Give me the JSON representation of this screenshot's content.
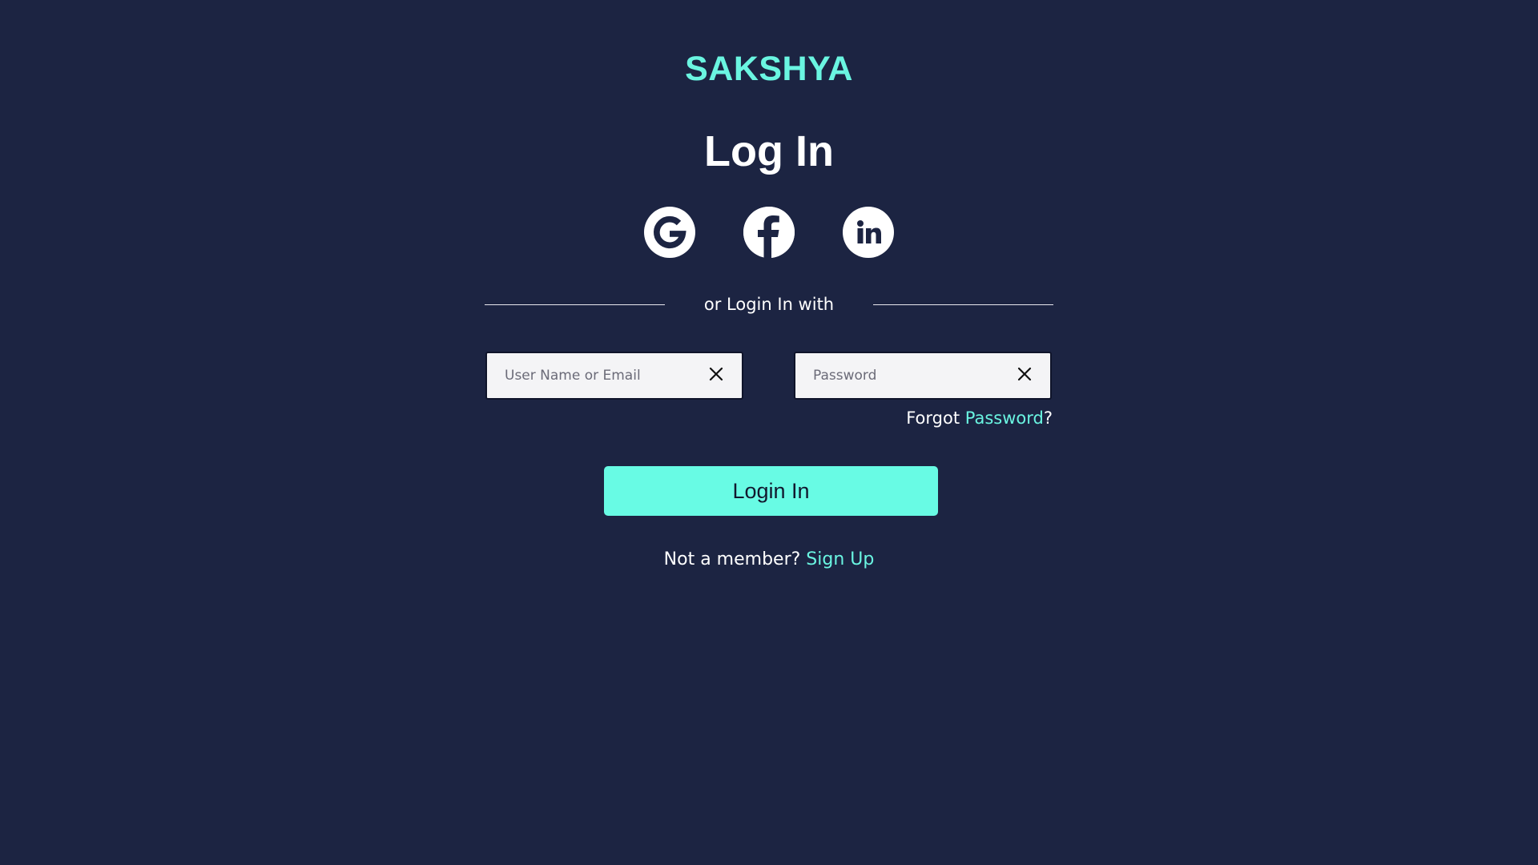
{
  "brand": {
    "name": "SAKSHYA"
  },
  "heading": "Log In",
  "social": {
    "google_icon": "google-icon",
    "facebook_icon": "facebook-icon",
    "linkedin_icon": "linkedin-icon"
  },
  "divider_text": "or Login In with",
  "form": {
    "username": {
      "placeholder": "User Name or Email",
      "value": ""
    },
    "password": {
      "placeholder": "Password",
      "value": ""
    },
    "forgot_prefix": "Forgot ",
    "forgot_link": "Password",
    "forgot_suffix": "?",
    "submit_label": "Login In"
  },
  "signup": {
    "prompt": "Not a member? ",
    "link": "Sign Up"
  },
  "colors": {
    "background": "#1c2442",
    "accent": "#6af5e1",
    "button": "#68fbe4",
    "field_bg": "#f4f4f6",
    "text": "#ffffff"
  }
}
